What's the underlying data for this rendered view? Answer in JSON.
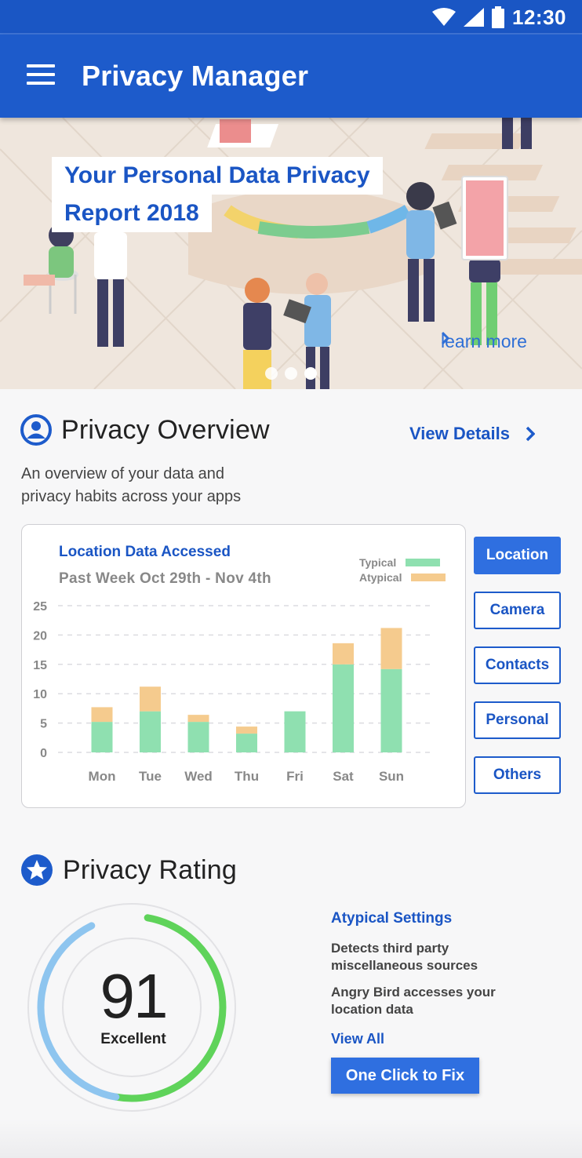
{
  "status_bar": {
    "time": "12:30"
  },
  "app_bar": {
    "title": "Privacy Manager"
  },
  "hero": {
    "title_line1": "Your Personal Data Privacy",
    "title_line2": "Report 2018",
    "learn_more": "learn more",
    "carousel_dots": 3,
    "active_dot": 3
  },
  "overview": {
    "title": "Privacy Overview",
    "view_details": "View Details",
    "description_line1": "An overview of your data and",
    "description_line2": "privacy habits across your apps"
  },
  "filters": [
    "Location",
    "Camera",
    "Contacts",
    "Personal",
    "Others"
  ],
  "active_filter": "Location",
  "chart_data": {
    "type": "bar",
    "stacked": true,
    "title": "Location Data Accessed",
    "subtitle": "Past Week Oct 29th - Nov 4th",
    "categories": [
      "Mon",
      "Tue",
      "Wed",
      "Thu",
      "Fri",
      "Sat",
      "Sun"
    ],
    "series": [
      {
        "name": "Typical",
        "color": "#8fe0b0",
        "values": [
          5.2,
          7,
          5.2,
          3.2,
          7,
          15,
          14.2
        ]
      },
      {
        "name": "Atypical",
        "color": "#f5cb8e",
        "values": [
          2.5,
          4.2,
          1.2,
          1.2,
          0,
          3.6,
          7
        ]
      }
    ],
    "yticks": [
      0,
      5,
      10,
      15,
      20,
      25
    ],
    "ylim": [
      0,
      25
    ],
    "grid": true,
    "legend_position": "top-right"
  },
  "rating": {
    "title": "Privacy Rating",
    "score": "91",
    "score_value": 91,
    "label": "Excellent",
    "atypical_title": "Atypical Settings",
    "item1_line1": "Detects third party",
    "item1_line2": "miscellaneous sources",
    "item2_line1": "Angry Bird accesses your",
    "item2_line2": "location data",
    "view_all": "View All",
    "fix_button": "One Click to Fix"
  },
  "colors": {
    "primary": "#1d5bcb",
    "accent_button": "#2f6fe0",
    "typical": "#8fe0b0",
    "atypical": "#f5cb8e",
    "gauge_blue": "#8ec5ef",
    "gauge_green": "#5fd35a"
  }
}
